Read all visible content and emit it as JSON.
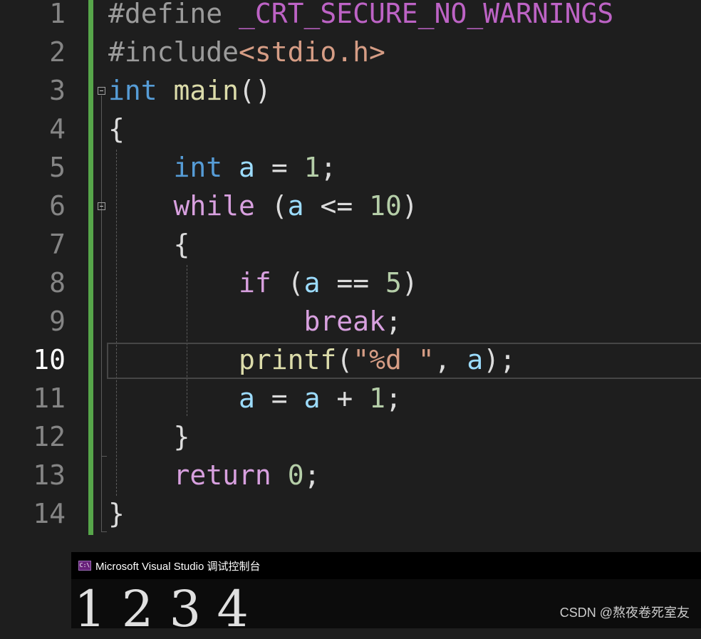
{
  "editor": {
    "line_numbers": [
      "1",
      "2",
      "3",
      "4",
      "5",
      "6",
      "7",
      "8",
      "9",
      "10",
      "11",
      "12",
      "13",
      "14"
    ],
    "current_line": "10",
    "lines": [
      [
        {
          "t": "#define ",
          "c": "pre"
        },
        {
          "t": "_CRT_SECURE_NO_WARNINGS",
          "c": "macro"
        }
      ],
      [
        {
          "t": "#include",
          "c": "pre"
        },
        {
          "t": "<stdio.h>",
          "c": "inc"
        }
      ],
      [
        {
          "t": "int",
          "c": "type"
        },
        {
          "t": " ",
          "c": "p"
        },
        {
          "t": "main",
          "c": "fn"
        },
        {
          "t": "()",
          "c": "p"
        }
      ],
      [
        {
          "t": "{",
          "c": "p"
        }
      ],
      [
        {
          "t": "    ",
          "c": "p"
        },
        {
          "t": "int",
          "c": "type"
        },
        {
          "t": " ",
          "c": "p"
        },
        {
          "t": "a",
          "c": "var"
        },
        {
          "t": " = ",
          "c": "p"
        },
        {
          "t": "1",
          "c": "num"
        },
        {
          "t": ";",
          "c": "p"
        }
      ],
      [
        {
          "t": "    ",
          "c": "p"
        },
        {
          "t": "while",
          "c": "ctrl"
        },
        {
          "t": " (",
          "c": "p"
        },
        {
          "t": "a",
          "c": "var"
        },
        {
          "t": " <= ",
          "c": "p"
        },
        {
          "t": "10",
          "c": "num"
        },
        {
          "t": ")",
          "c": "p"
        }
      ],
      [
        {
          "t": "    {",
          "c": "p"
        }
      ],
      [
        {
          "t": "        ",
          "c": "p"
        },
        {
          "t": "if",
          "c": "ctrl"
        },
        {
          "t": " (",
          "c": "p"
        },
        {
          "t": "a",
          "c": "var"
        },
        {
          "t": " == ",
          "c": "p"
        },
        {
          "t": "5",
          "c": "num"
        },
        {
          "t": ")",
          "c": "p"
        }
      ],
      [
        {
          "t": "            ",
          "c": "p"
        },
        {
          "t": "break",
          "c": "ctrl"
        },
        {
          "t": ";",
          "c": "p"
        }
      ],
      [
        {
          "t": "        ",
          "c": "p"
        },
        {
          "t": "printf",
          "c": "fn"
        },
        {
          "t": "(",
          "c": "p"
        },
        {
          "t": "\"%d \"",
          "c": "str"
        },
        {
          "t": ", ",
          "c": "p"
        },
        {
          "t": "a",
          "c": "var"
        },
        {
          "t": ");",
          "c": "p"
        }
      ],
      [
        {
          "t": "        ",
          "c": "p"
        },
        {
          "t": "a",
          "c": "var"
        },
        {
          "t": " = ",
          "c": "p"
        },
        {
          "t": "a",
          "c": "var"
        },
        {
          "t": " + ",
          "c": "p"
        },
        {
          "t": "1",
          "c": "num"
        },
        {
          "t": ";",
          "c": "p"
        }
      ],
      [
        {
          "t": "    }",
          "c": "p"
        }
      ],
      [
        {
          "t": "    ",
          "c": "p"
        },
        {
          "t": "return",
          "c": "ctrl"
        },
        {
          "t": " ",
          "c": "p"
        },
        {
          "t": "0",
          "c": "num"
        },
        {
          "t": ";",
          "c": "p"
        }
      ],
      [
        {
          "t": "}",
          "c": "p"
        }
      ]
    ]
  },
  "colors": {
    "background": "#1e1e1e",
    "line_number": "#858585",
    "change_bar": "#57a64a",
    "keyword_type": "#569cd6",
    "keyword_control": "#d8a0df",
    "function": "#dcdcaa",
    "variable": "#9cdcfe",
    "number": "#b5cea8",
    "string": "#d69d85",
    "macro": "#bd63c5"
  },
  "console": {
    "icon": "console-app-icon",
    "icon_text": "C:\\",
    "title": "Microsoft Visual Studio 调试控制台",
    "output": "1 2 3 4"
  },
  "watermark": "CSDN @熬夜卷死室友"
}
